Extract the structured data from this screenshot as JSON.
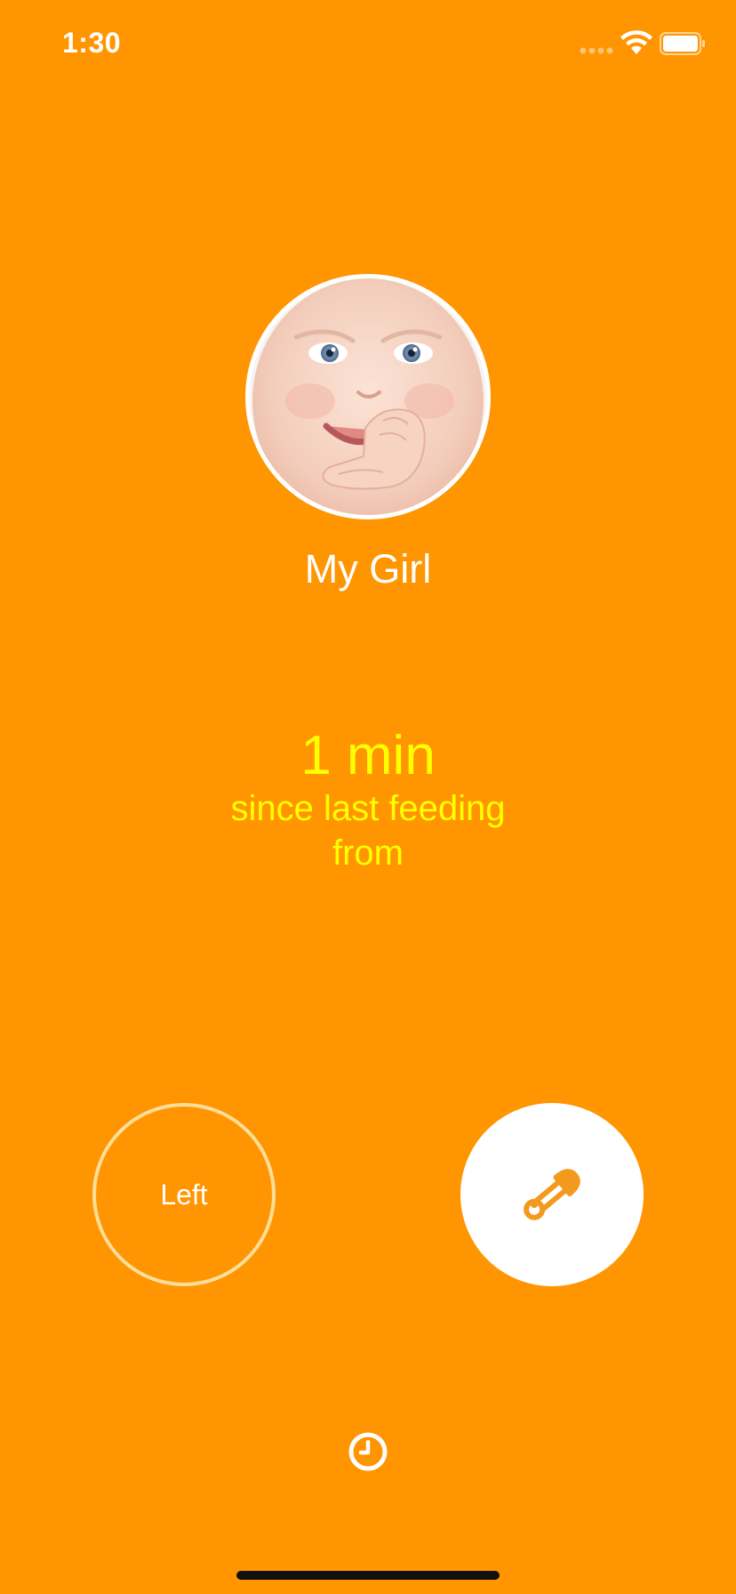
{
  "status_bar": {
    "time": "1:30",
    "icons": [
      "signal-icon",
      "wifi-icon",
      "battery-icon"
    ]
  },
  "profile": {
    "name": "My Girl",
    "avatar_icon": "baby-photo"
  },
  "feeding": {
    "elapsed": "1 min",
    "since_label": "since last feeding",
    "from_label": "from"
  },
  "actions": {
    "left_label": "Left",
    "diaper_icon": "safety-pin-icon",
    "history_icon": "clock-icon"
  },
  "colors": {
    "background": "#FF9500",
    "accent_text": "#FFFF00",
    "white": "#FFFFFF"
  }
}
